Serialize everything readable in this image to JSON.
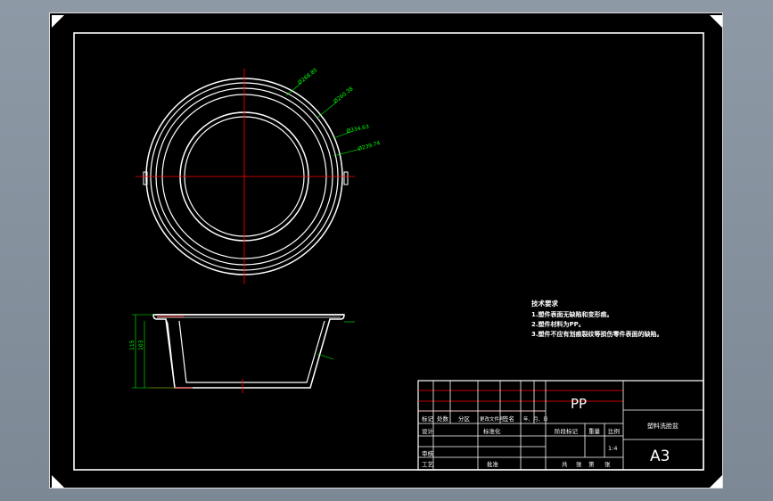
{
  "drawing": {
    "top_view_dimensions": [
      "Ø268.85",
      "Ø260.38",
      "Ø334.63",
      "Ø239.74"
    ],
    "section_dimensions": {
      "height_outer": "115",
      "height_inner": "103"
    },
    "notes_title": "技术要求",
    "notes": [
      "1.塑件表面无缺陷和变形痕。",
      "2.塑件材料为PP。",
      "3.塑件不应有划痕裂纹等损伤零件表面的缺陷。"
    ]
  },
  "title_block": {
    "material": "PP",
    "part_name": "塑料洗脸盆",
    "sheet_size": "A3",
    "scale": "1:4",
    "revision_headers": [
      "标记",
      "处数",
      "分区",
      "更改文件号",
      "签名",
      "年、月、日"
    ],
    "labels": {
      "design": "设计",
      "standardization": "标准化",
      "review": "审核",
      "process": "工艺",
      "approve": "批准",
      "stage_mark": "阶段标记",
      "weight": "重量",
      "ratio": "比例",
      "total_sheets": "共",
      "sheets_unit": "张",
      "sheet_no": "第",
      "sheet_unit": "张"
    }
  }
}
